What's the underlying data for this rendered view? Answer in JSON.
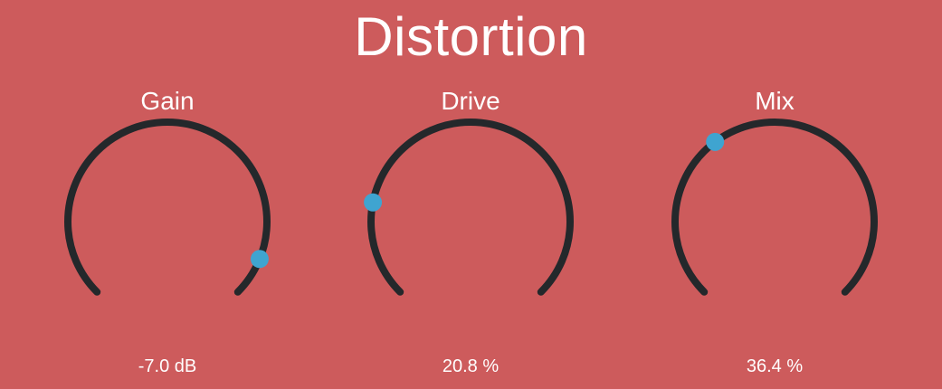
{
  "plugin": {
    "title": "Distortion"
  },
  "colors": {
    "background": "#cd5b5c",
    "track": "#24282b",
    "handle": "#3fa4d0",
    "text": "#ffffff"
  },
  "knobs": [
    {
      "id": "gain",
      "label": "Gain",
      "value_text": "-7.0 dB",
      "normalized": 0.915
    },
    {
      "id": "drive",
      "label": "Drive",
      "value_text": "20.8 %",
      "normalized": 0.208
    },
    {
      "id": "mix",
      "label": "Mix",
      "value_text": "36.4 %",
      "normalized": 0.364
    }
  ]
}
